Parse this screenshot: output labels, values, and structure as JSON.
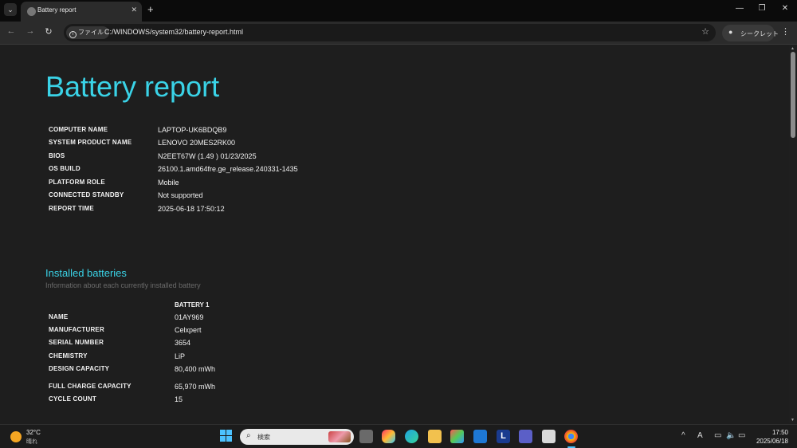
{
  "browser": {
    "tab_title": "Battery report",
    "chip_label": "ファイル",
    "url": "C:/WINDOWS/system32/battery-report.html",
    "incognito_label": "シークレット"
  },
  "report": {
    "title": "Battery report",
    "system_info": [
      {
        "key": "COMPUTER NAME",
        "value": "LAPTOP-UK6BDQB9"
      },
      {
        "key": "SYSTEM PRODUCT NAME",
        "value": "LENOVO 20MES2RK00"
      },
      {
        "key": "BIOS",
        "value": "N2EET67W (1.49 ) 01/23/2025"
      },
      {
        "key": "OS BUILD",
        "value": "26100.1.amd64fre.ge_release.240331-1435"
      },
      {
        "key": "PLATFORM ROLE",
        "value": "Mobile"
      },
      {
        "key": "CONNECTED STANDBY",
        "value": "Not supported"
      },
      {
        "key": "REPORT TIME",
        "value": "2025-06-18   17:50:12"
      }
    ],
    "installed": {
      "title": "Installed batteries",
      "subtitle": "Information about each currently installed battery",
      "column": "BATTERY 1",
      "rows": [
        {
          "key": "NAME",
          "value": "01AY969"
        },
        {
          "key": "MANUFACTURER",
          "value": "Celxpert"
        },
        {
          "key": "SERIAL NUMBER",
          "value": "3654"
        },
        {
          "key": "CHEMISTRY",
          "value": "LiP"
        },
        {
          "key": "DESIGN CAPACITY",
          "value": "80,400 mWh"
        },
        {
          "key": "FULL CHARGE CAPACITY",
          "value": "65,970 mWh"
        },
        {
          "key": "CYCLE COUNT",
          "value": "15"
        }
      ]
    }
  },
  "taskbar": {
    "weather_temp": "32°C",
    "weather_cond": "晴れ",
    "search_label": "検索",
    "clock_time": "17:50",
    "clock_date": "2025/06/18"
  },
  "colors": {
    "accent": "#3ad3e7",
    "background": "#1e1e1e"
  }
}
